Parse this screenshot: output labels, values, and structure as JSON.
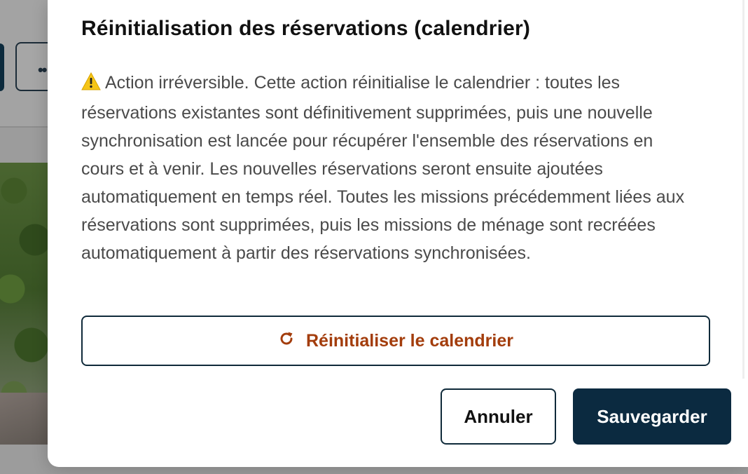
{
  "background": {
    "more_button_label": "••"
  },
  "dialog": {
    "title": "Réinitialisation des réservations (calendrier)",
    "warning_icon": "warning-triangle-icon",
    "warning_text": "Action irréversible. Cette action réinitialise le calendrier : toutes les réservations existantes sont définitivement supprimées, puis une nouvelle synchronisation est lancée pour récupérer l'ensemble des réservations en cours et à venir. Les nouvelles réservations seront ensuite ajoutées automatiquement en temps réel. Toutes les missions précédemment liées aux réservations sont supprimées, puis les missions de ménage sont recréées automatiquement à partir des réservations synchronisées.",
    "reset_button": {
      "icon": "refresh-icon",
      "label": "Réinitialiser le calendrier"
    },
    "cancel_label": "Annuler",
    "save_label": "Sauvegarder"
  },
  "colors": {
    "primary": "#0b2a40",
    "accent": "#a33d0c",
    "warning": "#f5c518"
  }
}
